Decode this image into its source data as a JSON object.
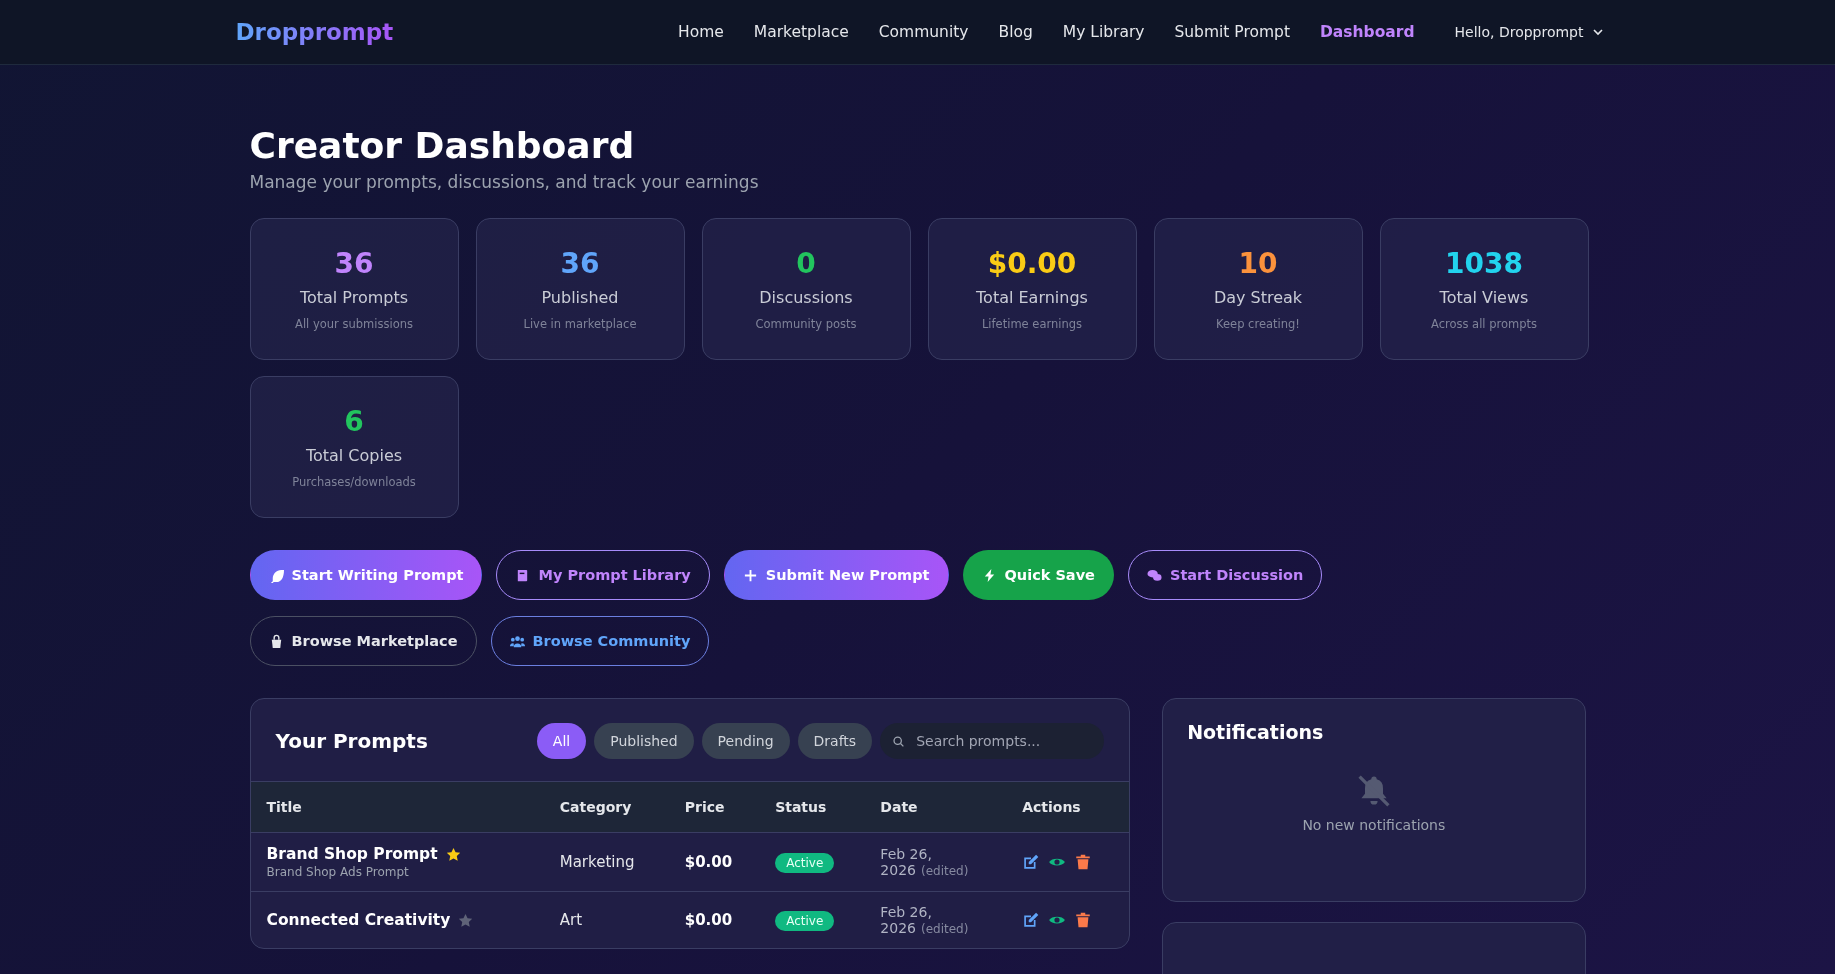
{
  "navbar": {
    "logo": "Dropprompt",
    "links": [
      {
        "label": "Home",
        "selected": false
      },
      {
        "label": "Marketplace",
        "selected": false
      },
      {
        "label": "Community",
        "selected": false
      },
      {
        "label": "Blog",
        "selected": false
      },
      {
        "label": "My Library",
        "selected": false
      },
      {
        "label": "Submit Prompt",
        "selected": false
      },
      {
        "label": "Dashboard",
        "selected": true
      }
    ],
    "user_menu": "Hello, Dropprompt"
  },
  "header": {
    "title": "Creator Dashboard",
    "subtitle": "Manage your prompts, discussions, and track your earnings"
  },
  "stats": [
    {
      "value": "36",
      "label": "Total Prompts",
      "note": "All your submissions",
      "color": "#c084fc"
    },
    {
      "value": "36",
      "label": "Published",
      "note": "Live in marketplace",
      "color": "#60a5fa"
    },
    {
      "value": "0",
      "label": "Discussions",
      "note": "Community posts",
      "color": "#22c55e"
    },
    {
      "value": "$0.00",
      "label": "Total Earnings",
      "note": "Lifetime earnings",
      "color": "#facc15"
    },
    {
      "value": "10",
      "label": "Day Streak",
      "note": "Keep creating!",
      "color": "#fb923c"
    },
    {
      "value": "1038",
      "label": "Total Views",
      "note": "Across all prompts",
      "color": "#22d3ee"
    },
    {
      "value": "6",
      "label": "Total Copies",
      "note": "Purchases/downloads",
      "color": "#22c55e"
    }
  ],
  "actions": [
    {
      "label": "Start Writing Prompt",
      "kind": "gradient"
    },
    {
      "label": "My Prompt Library",
      "kind": "outline"
    },
    {
      "label": "Submit New Prompt",
      "kind": "gradient"
    },
    {
      "label": "Quick Save",
      "kind": "green"
    },
    {
      "label": "Start Discussion",
      "kind": "outline"
    },
    {
      "label": "Browse Marketplace",
      "kind": "plain"
    },
    {
      "label": "Browse Community",
      "kind": "blue"
    }
  ],
  "prompts": {
    "title": "Your Prompts",
    "filters": [
      {
        "label": "All",
        "selected": true
      },
      {
        "label": "Published",
        "selected": false
      },
      {
        "label": "Pending",
        "selected": false
      },
      {
        "label": "Drafts",
        "selected": false
      }
    ],
    "search": {
      "placeholder": "Search prompts..."
    },
    "columns": [
      "Title",
      "Category",
      "Price",
      "Status",
      "Date",
      "Actions"
    ],
    "rows": [
      {
        "title": "Brand Shop Prompt",
        "subtitle": "Brand Shop Ads Prompt",
        "starred": true,
        "category": "Marketing",
        "price": "$0.00",
        "status": "Active",
        "date": "Feb 26,",
        "date_2": "2026",
        "edited": "(edited)"
      },
      {
        "title": "Connected Creativity",
        "starred": false,
        "category": "Art",
        "price": "$0.00",
        "status": "Active",
        "date": "Feb 26,",
        "date_2": "2026",
        "edited": "(edited)"
      }
    ]
  },
  "notifications": {
    "title": "Notifications",
    "empty": "No new notifications"
  }
}
